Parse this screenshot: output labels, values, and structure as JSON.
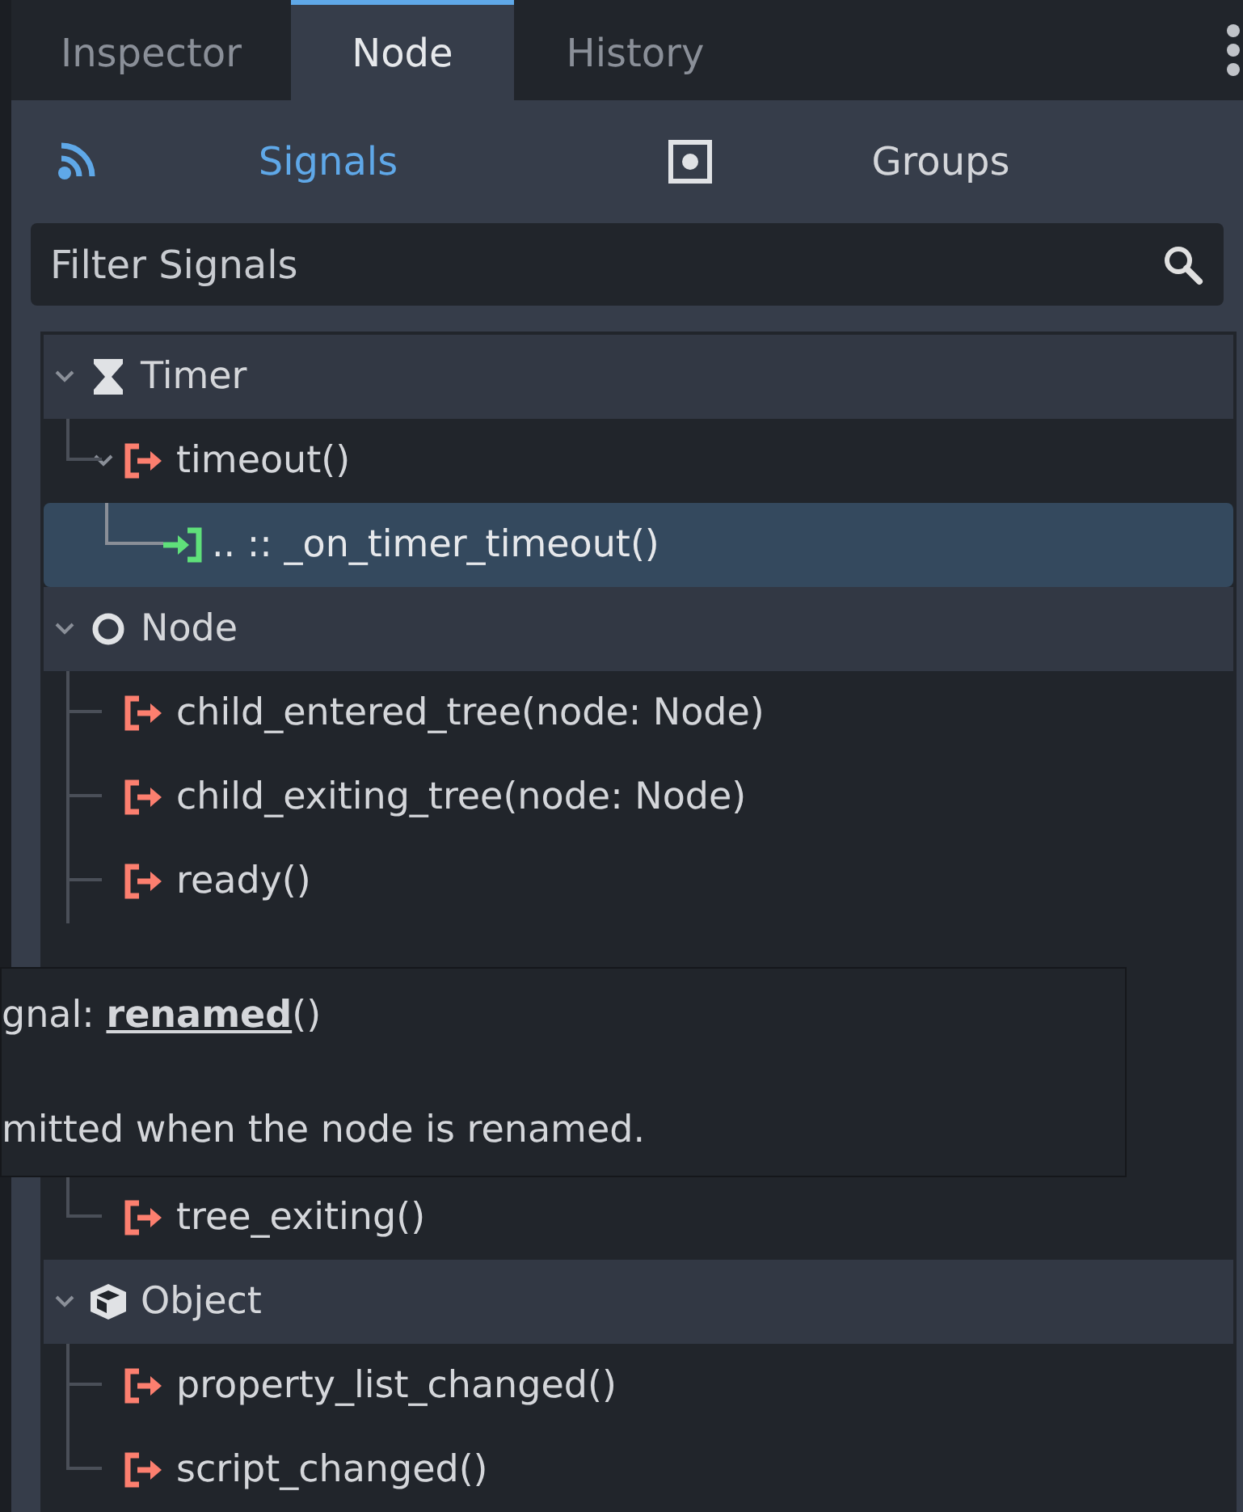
{
  "tabs": [
    {
      "label": "Inspector",
      "selected": false
    },
    {
      "label": "Node",
      "selected": true
    },
    {
      "label": "History",
      "selected": false
    }
  ],
  "subtabs": [
    {
      "label": "Signals",
      "selected": true
    },
    {
      "label": "Groups",
      "selected": false
    }
  ],
  "filter": {
    "placeholder": "Filter Signals"
  },
  "tree": [
    {
      "label": "Timer",
      "expanded": true,
      "children": [
        {
          "label": "timeout()",
          "kind": "signal",
          "expanded": true,
          "selected": false,
          "children": [
            {
              "label": ".. :: _on_timer_timeout()",
              "kind": "connection",
              "selected": true
            }
          ]
        }
      ]
    },
    {
      "label": "Node",
      "expanded": true,
      "children": [
        {
          "label": "child_entered_tree(node: Node)",
          "kind": "signal",
          "selected": false
        },
        {
          "label": "child_exiting_tree(node: Node)",
          "kind": "signal",
          "selected": false
        },
        {
          "label": "ready()",
          "kind": "signal",
          "selected": false
        },
        {
          "label": "tree_exiting()",
          "kind": "signal",
          "selected": false
        }
      ]
    },
    {
      "label": "Object",
      "expanded": true,
      "children": [
        {
          "label": "property_list_changed()",
          "kind": "signal",
          "selected": false
        },
        {
          "label": "script_changed()",
          "kind": "signal",
          "selected": false
        }
      ]
    }
  ],
  "tooltip": {
    "title": "gnal: **renamed**()",
    "description": "mitted when the node is renamed."
  }
}
